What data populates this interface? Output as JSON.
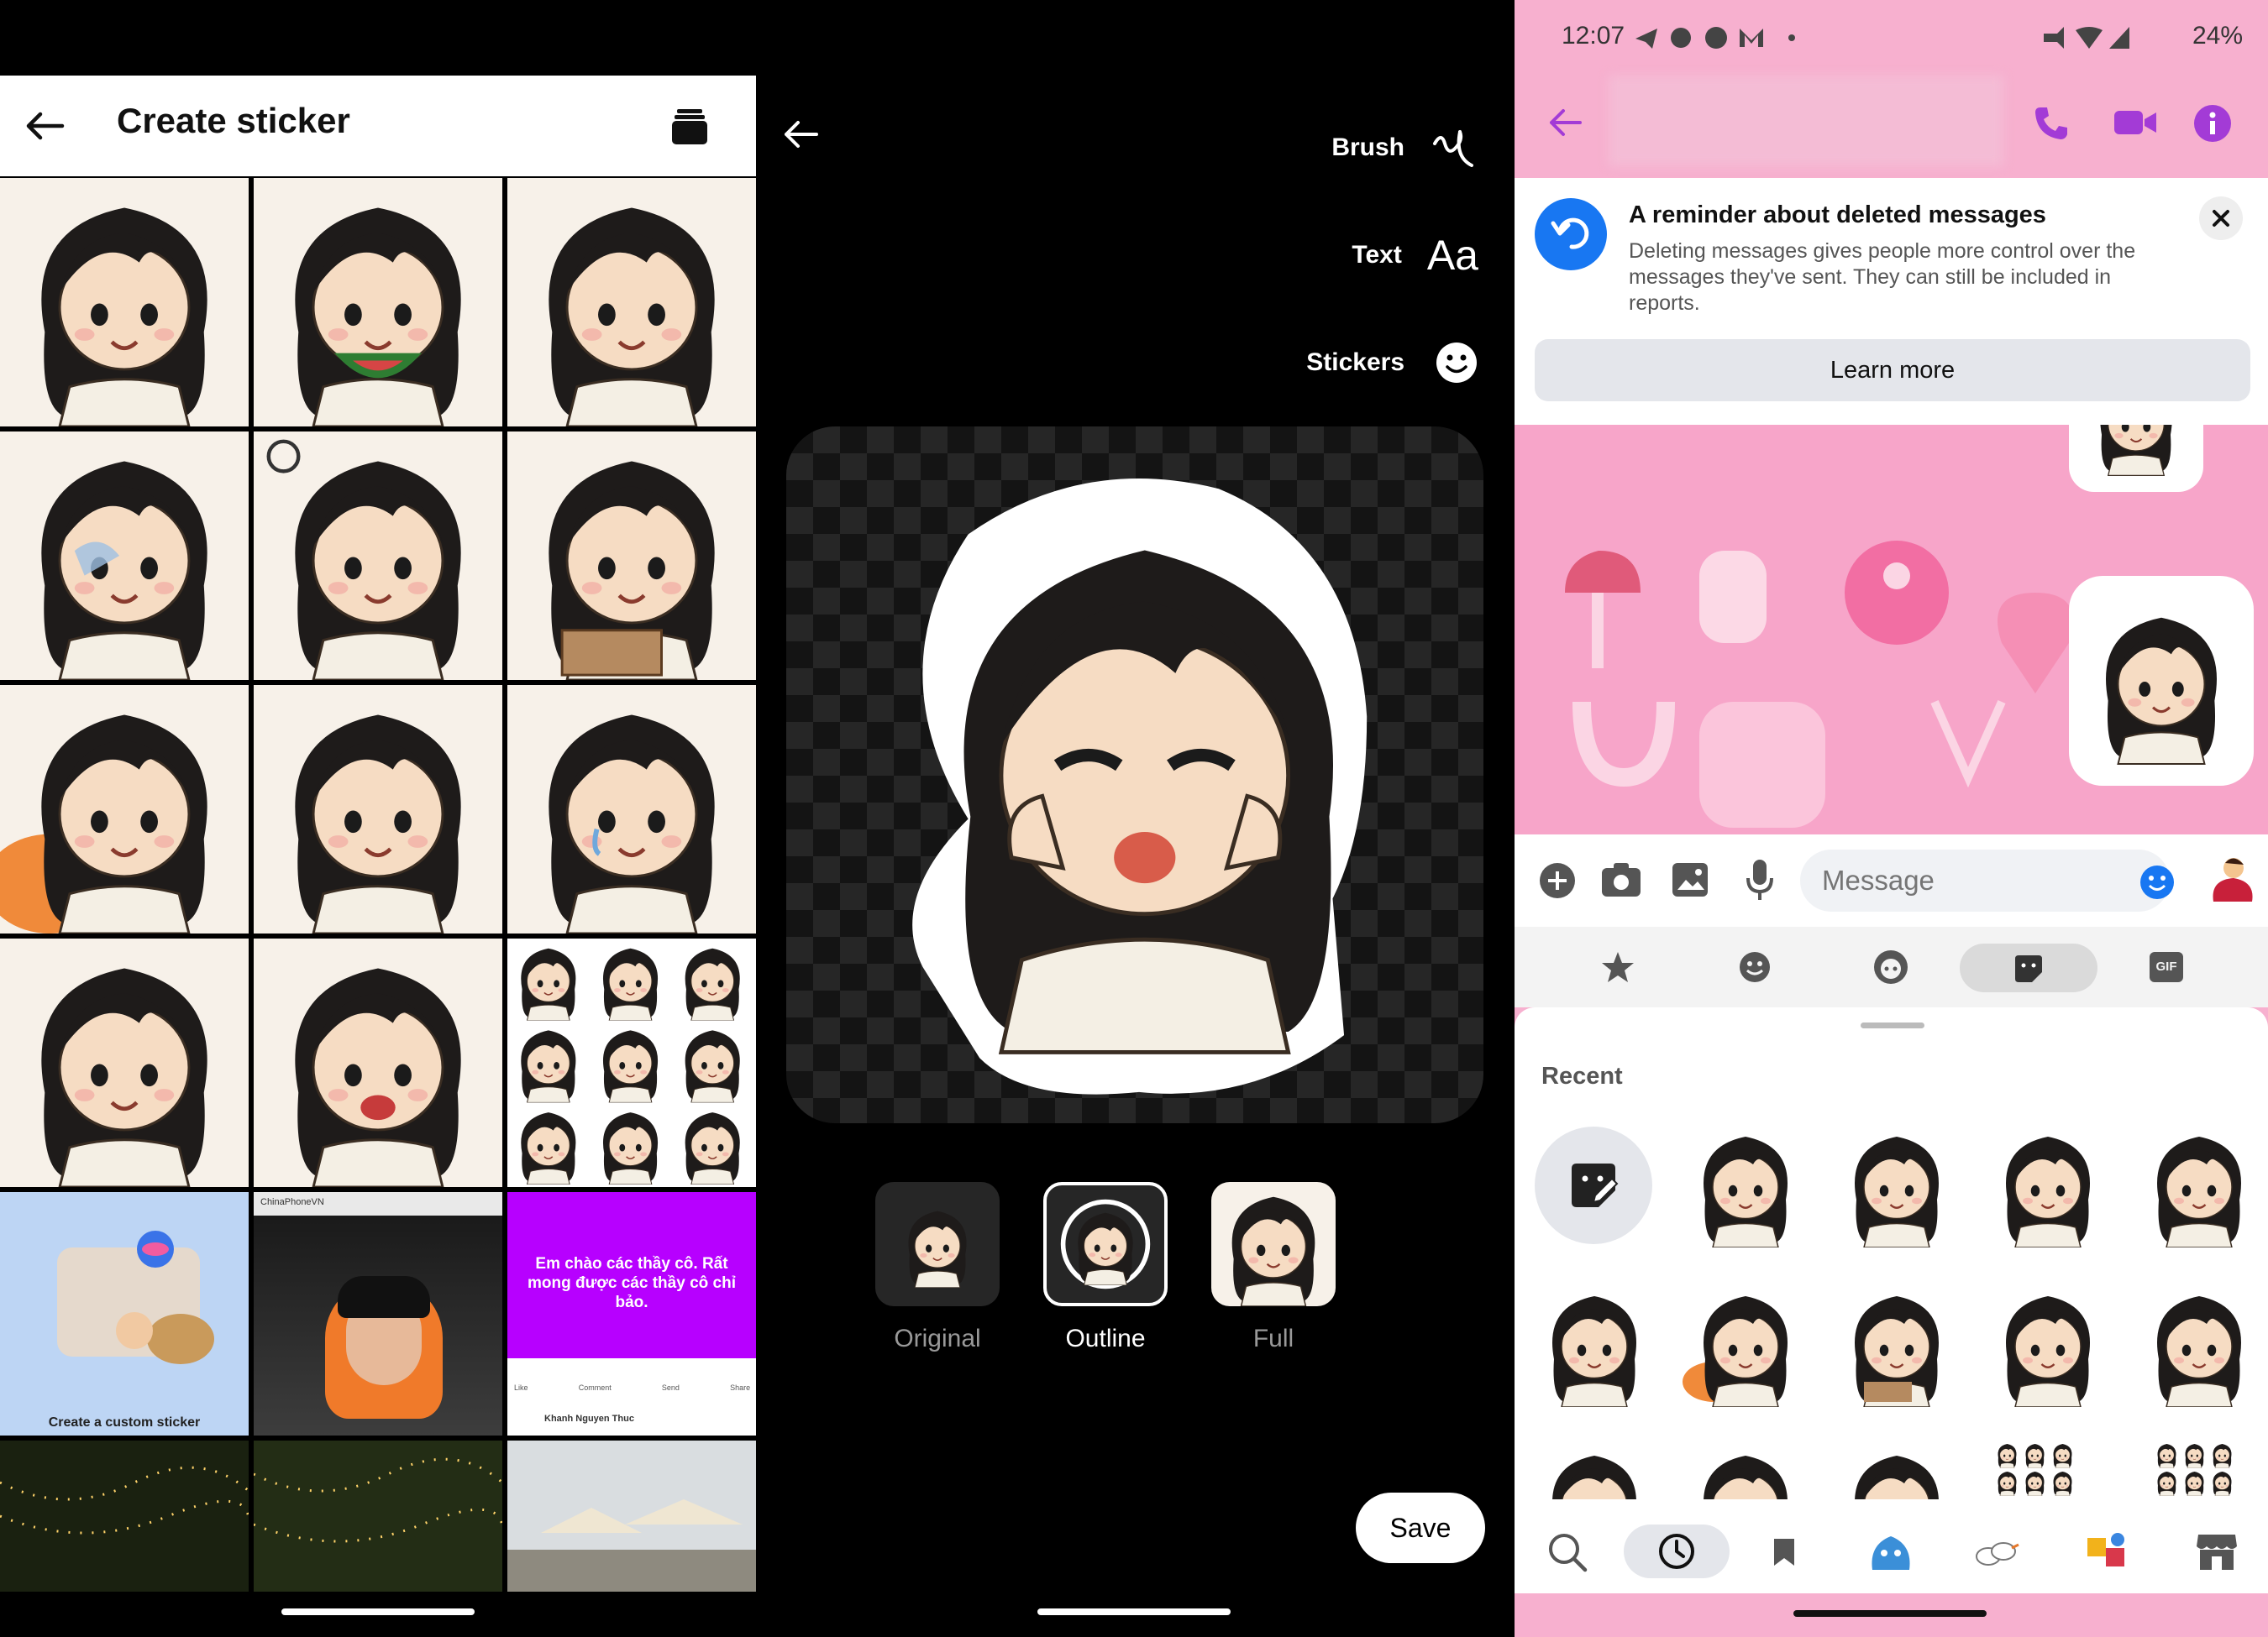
{
  "panel1": {
    "title": "Create sticker",
    "custom_label": "Create a custom sticker",
    "photo_caption": "ChinaPhoneVN",
    "post_text": "Em chào các thầy cô. Rất mong được các thầy cô chỉ bảo.",
    "post_actions": [
      "Like",
      "Comment",
      "Send",
      "Share"
    ],
    "post_author": "Khanh Nguyen Thuc"
  },
  "panel2": {
    "tools": [
      "Brush",
      "Text",
      "Stickers"
    ],
    "text_glyph": "Aa",
    "options": [
      "Original",
      "Outline",
      "Full"
    ],
    "selected_option": "Outline",
    "save": "Save"
  },
  "panel3": {
    "status": {
      "time": "12:07",
      "battery": "24%"
    },
    "reminder": {
      "title": "A reminder about deleted messages",
      "body": "Deleting messages gives people more control over the messages they've sent. They can still be included in reports.",
      "button": "Learn more"
    },
    "composer_placeholder": "Message",
    "tray": {
      "recent_label": "Recent"
    },
    "tray_tabs": [
      "star",
      "emoji",
      "avatar",
      "sticker",
      "GIF"
    ],
    "gif_label": "GIF"
  },
  "colors": {
    "messenger_blue": "#1877f2",
    "pink_theme": "#f7b0cf",
    "purple_accent": "#a33bd6",
    "white": "#ffffff",
    "black": "#000000"
  }
}
